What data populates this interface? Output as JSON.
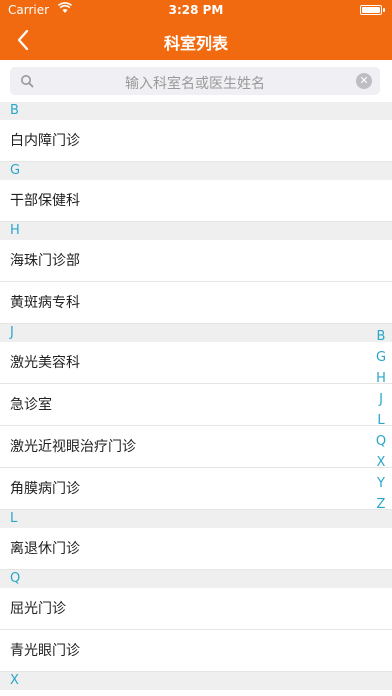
{
  "status": {
    "carrier": "Carrier",
    "time": "3:28 PM"
  },
  "nav": {
    "title": "科室列表",
    "back_icon": "chevron-left-icon"
  },
  "search": {
    "placeholder": "输入科室名或医生姓名",
    "icon": "search-icon",
    "clear_icon": "clear-icon"
  },
  "sections": [
    {
      "letter": "B",
      "items": [
        "白内障门诊"
      ]
    },
    {
      "letter": "G",
      "items": [
        "干部保健科"
      ]
    },
    {
      "letter": "H",
      "items": [
        "海珠门诊部",
        "黄斑病专科"
      ]
    },
    {
      "letter": "J",
      "items": [
        "激光美容科",
        "急诊室",
        "激光近视眼治疗门诊",
        "角膜病门诊"
      ]
    },
    {
      "letter": "L",
      "items": [
        "离退休门诊"
      ]
    },
    {
      "letter": "Q",
      "items": [
        "屈光门诊",
        "青光眼门诊"
      ]
    },
    {
      "letter": "X",
      "items": []
    }
  ],
  "index_letters": [
    "B",
    "G",
    "H",
    "J",
    "L",
    "Q",
    "X",
    "Y",
    "Z"
  ],
  "colors": {
    "header": "#f26a10",
    "accent": "#29a6c9",
    "section_bg": "#efefef"
  }
}
